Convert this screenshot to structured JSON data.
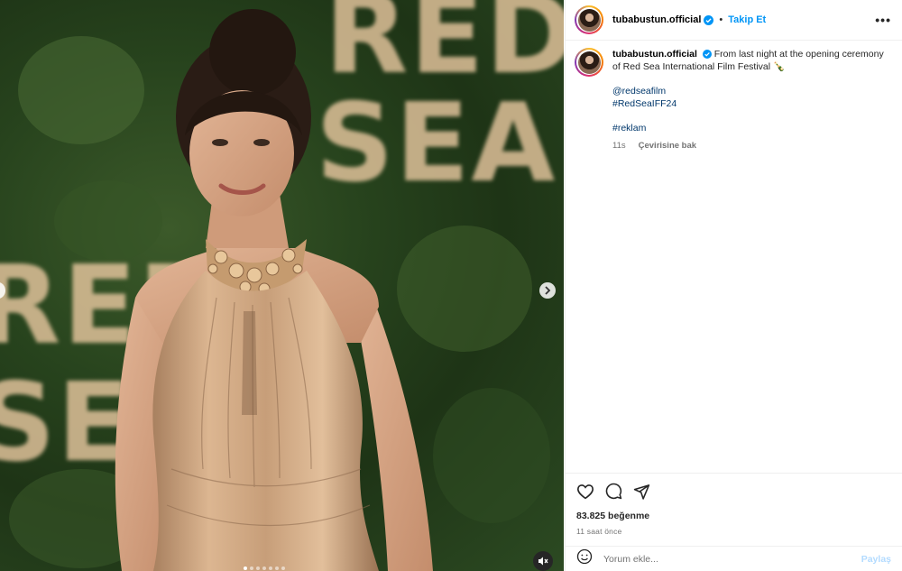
{
  "post": {
    "username": "tubabustun.official",
    "follow_label": "Takip Et",
    "more_icon": "more-horizontal-icon",
    "separator": "•"
  },
  "caption": {
    "username": "tubabustun.official",
    "text": "From last night at the opening ceremony of Red Sea International Film Festival 🍾",
    "mention": "@redseafilm",
    "hashtag1": "#RedSeaIFF24",
    "hashtag2": "#reklam",
    "age": "11s",
    "translate_label": "Çevirisine bak"
  },
  "engagement": {
    "likes": "83.825 beğenme",
    "timestamp": "11 saat önce"
  },
  "comment": {
    "placeholder": "Yorum ekle...",
    "post_label": "Paylaş"
  },
  "media": {
    "background_text_top": "RED",
    "background_text_second": "SEA",
    "background_text_left_top": "RED",
    "background_text_left_bottom": "SEA",
    "carousel_dots": 7,
    "active_dot": 0
  },
  "colors": {
    "accent": "#0095f6",
    "link": "#00376b",
    "dress": "#c9a07c",
    "background_foliage": "#27431d"
  }
}
